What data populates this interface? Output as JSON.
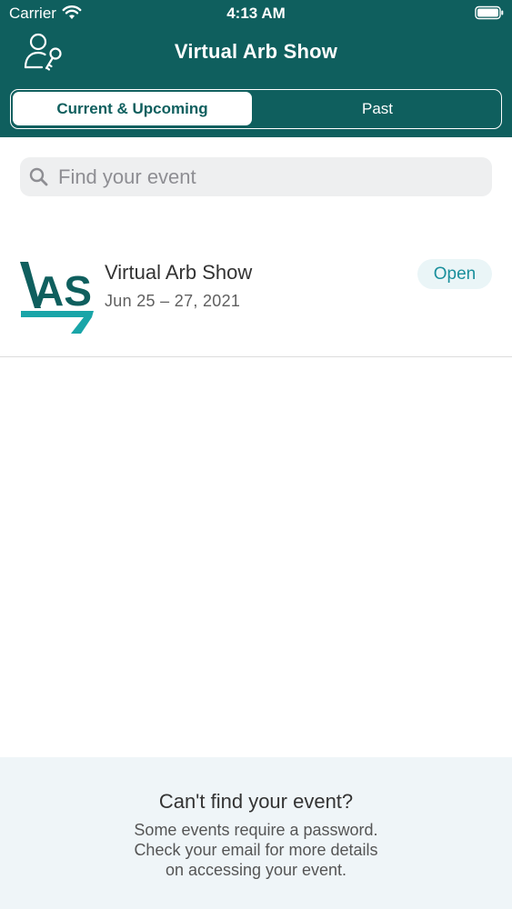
{
  "status_bar": {
    "carrier": "Carrier",
    "time": "4:13 AM"
  },
  "header": {
    "title": "Virtual Arb Show",
    "background_color": "#0f5f5e",
    "left_icon": "user-key-icon"
  },
  "tabs": [
    {
      "label": "Current & Upcoming",
      "selected": true
    },
    {
      "label": "Past",
      "selected": false
    }
  ],
  "search": {
    "placeholder": "Find your event",
    "value": ""
  },
  "events": [
    {
      "name": "Virtual Arb Show",
      "dates": "Jun 25 – 27, 2021",
      "status": "Open",
      "logo_text": "AS",
      "logo_color": "#0f5f5e",
      "logo_accent_color": "#19a5a8"
    }
  ],
  "footer": {
    "title": "Can't find your event?",
    "lines": [
      "Some events require a password.",
      "Check your email for more details",
      "on accessing your event."
    ]
  }
}
